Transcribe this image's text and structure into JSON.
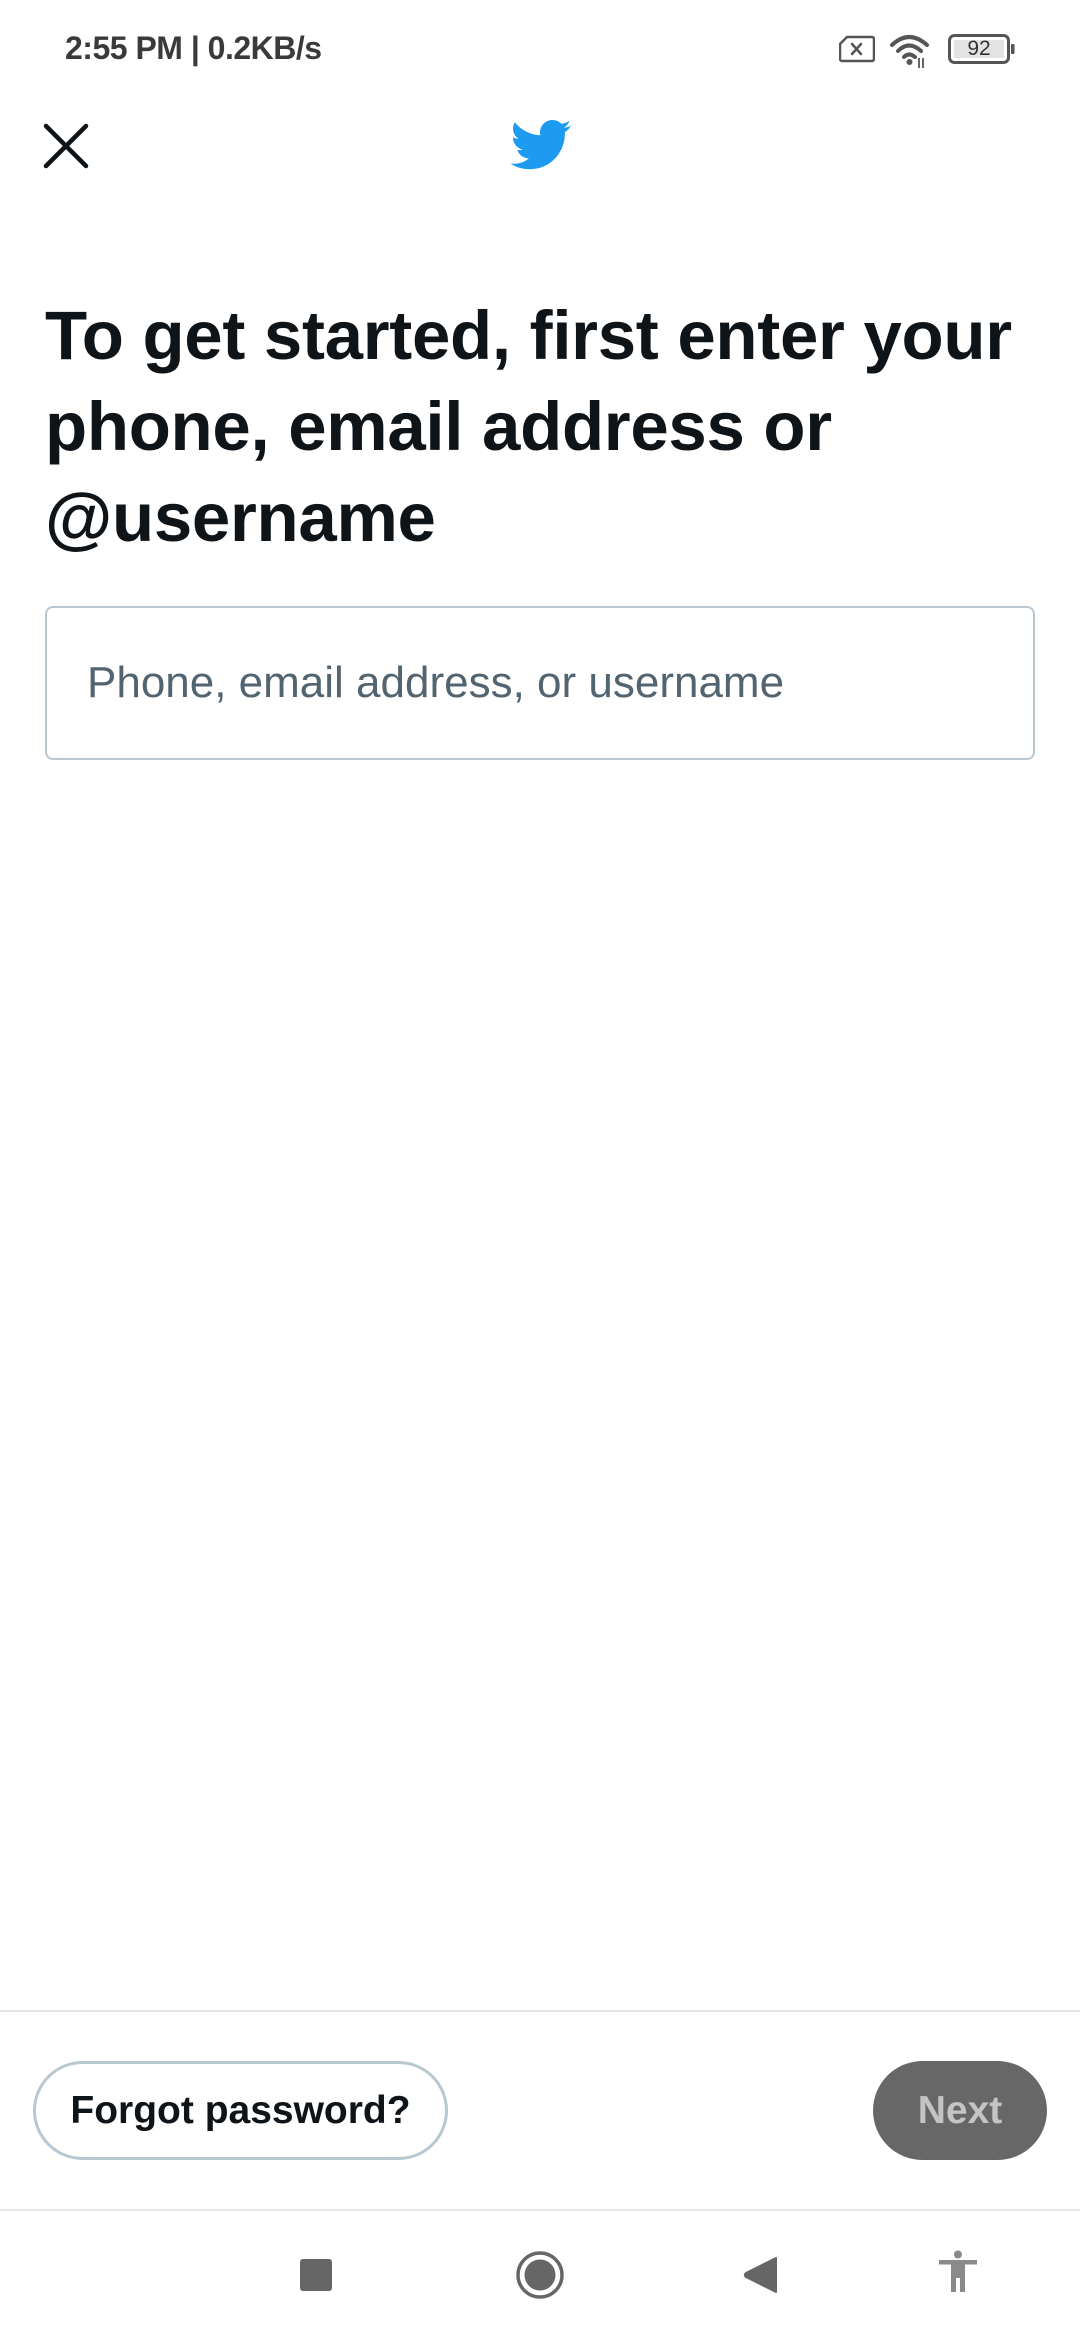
{
  "status_bar": {
    "time_and_speed": "2:55 PM | 0.2KB/s",
    "battery_level": "92",
    "icons": [
      "no-sim-icon",
      "wifi-icon",
      "battery-icon"
    ]
  },
  "top_bar": {
    "close_icon": "close-icon",
    "logo_icon": "twitter-bird-icon",
    "brand_color": "#1d9bf0"
  },
  "main": {
    "heading": "To get started, first enter your phone, email address or @username",
    "identifier_input": {
      "value": "",
      "placeholder": "Phone, email address, or username"
    }
  },
  "footer": {
    "forgot_password_label": "Forgot password?",
    "next_label": "Next",
    "next_enabled": false
  },
  "nav_bar": {
    "items": [
      "recents-icon",
      "home-icon",
      "back-icon",
      "accessibility-icon"
    ]
  }
}
